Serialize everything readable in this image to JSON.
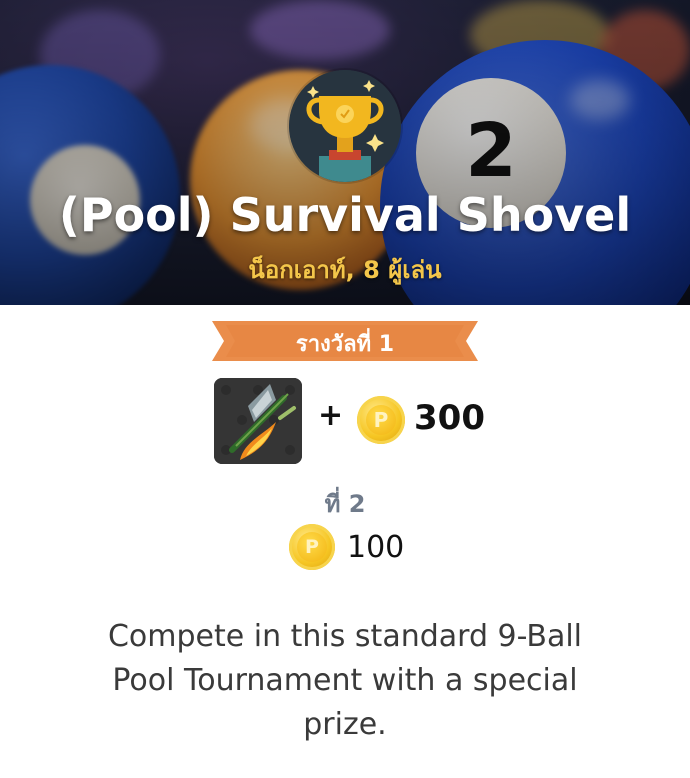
{
  "header": {
    "title": "(Pool) Survival Shovel",
    "subtitle": "น็อกเอาท์, 8 ผู้เล่น",
    "background_ball_number": "2"
  },
  "prizes": {
    "first": {
      "label": "รางวัลที่ 1",
      "item_icon": "shovel-cue-item-icon",
      "plus": "+",
      "coin_symbol": "P",
      "coins": "300"
    },
    "second": {
      "label": "ที่ 2",
      "coin_symbol": "P",
      "coins": "100"
    }
  },
  "description": "Compete in this standard 9-Ball Pool Tournament with a special prize.",
  "colors": {
    "ribbon": "#ea8d4b",
    "subtitle": "#f4c64a",
    "coin": "#f6c623",
    "second_label": "#6f7a8a"
  }
}
